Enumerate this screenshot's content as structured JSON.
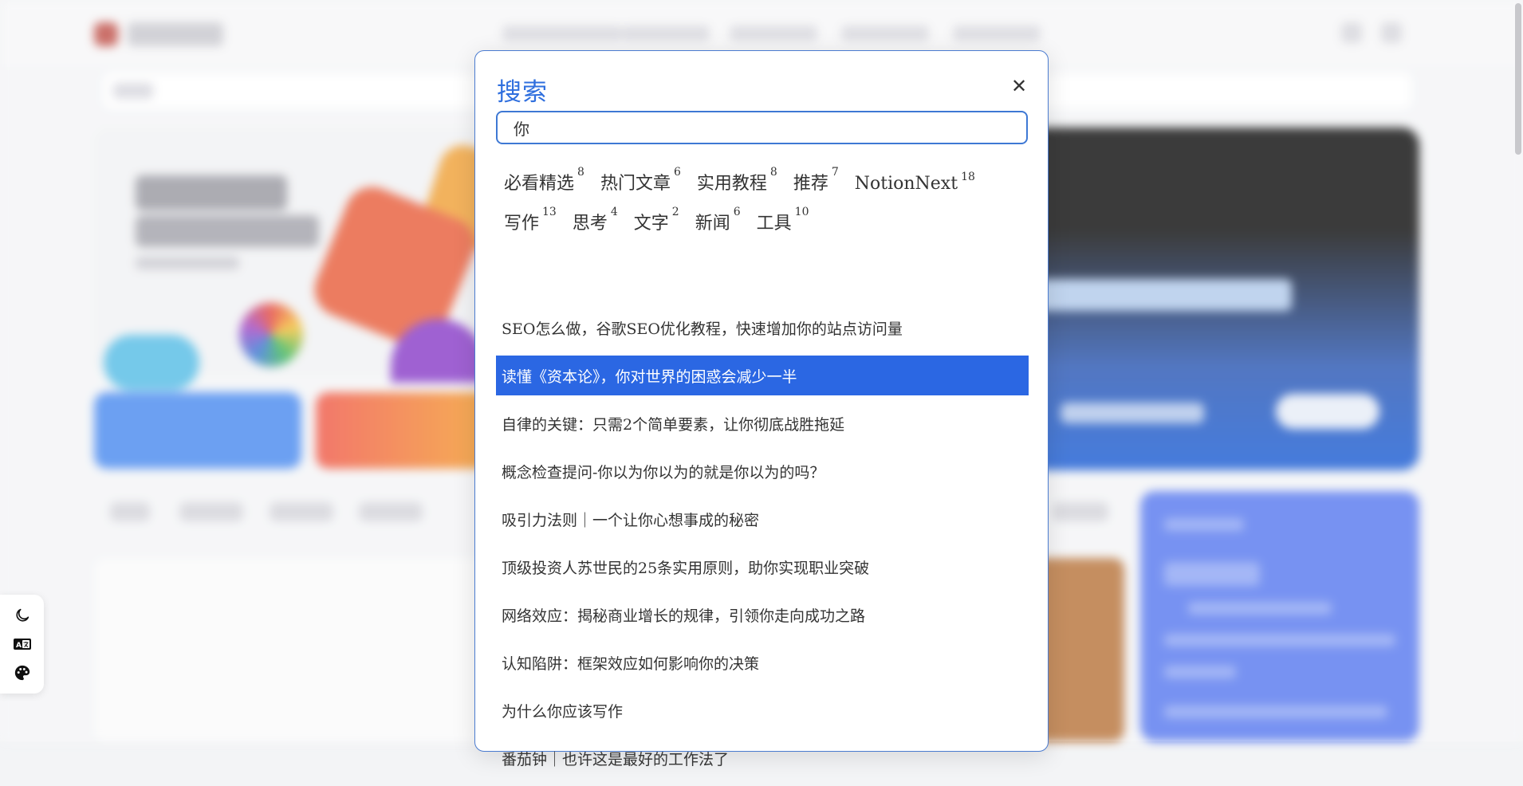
{
  "modal": {
    "title": "搜索",
    "close_icon": "close-icon",
    "search_value": "你"
  },
  "tags": [
    [
      {
        "label": "必看精选",
        "count": "8"
      },
      {
        "label": "热门文章",
        "count": "6"
      },
      {
        "label": "实用教程",
        "count": "8"
      },
      {
        "label": "推荐",
        "count": "7"
      },
      {
        "label": "NotionNext",
        "count": "18"
      }
    ],
    [
      {
        "label": "写作",
        "count": "13"
      },
      {
        "label": "思考",
        "count": "4"
      },
      {
        "label": "文字",
        "count": "2"
      },
      {
        "label": "新闻",
        "count": "6"
      },
      {
        "label": "工具",
        "count": "10"
      }
    ]
  ],
  "results": [
    {
      "title": "SEO怎么做，谷歌SEO优化教程，快速增加你的站点访问量",
      "active": false
    },
    {
      "title": "读懂《资本论》，你对世界的困惑会减少一半",
      "active": true
    },
    {
      "title": "自律的关键：只需2个简单要素，让你彻底战胜拖延",
      "active": false
    },
    {
      "title": "概念检查提问-你以为你以为的就是你以为的吗？",
      "active": false
    },
    {
      "title": "吸引力法则｜一个让你心想事成的秘密",
      "active": false
    },
    {
      "title": "顶级投资人苏世民的25条实用原则，助你实现职业突破",
      "active": false
    },
    {
      "title": "网络效应：揭秘商业增长的规律，引领你走向成功之路",
      "active": false
    },
    {
      "title": "认知陷阱：框架效应如何影响你的决策",
      "active": false
    },
    {
      "title": "为什么你应该写作",
      "active": false
    },
    {
      "title": "番茄钟｜也许这是最好的工作法了",
      "active": false
    }
  ],
  "toolbar": {
    "icons": [
      "moon-icon",
      "translate-icon",
      "palette-icon"
    ]
  },
  "colors": {
    "accent": "#2f6fde",
    "active_row": "#2b67e3",
    "modal_border": "#4a7bd0"
  }
}
